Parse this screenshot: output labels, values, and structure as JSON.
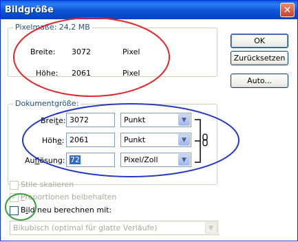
{
  "window": {
    "title": "Bildgröße",
    "close_glyph": "✕"
  },
  "pixel_dimensions": {
    "legend": "Pixelmaße: 24,2 MB",
    "width_label": "Breite:",
    "width_value": "3072",
    "width_unit": "Pixel",
    "height_label": "Höhe:",
    "height_value": "2061",
    "height_unit": "Pixel"
  },
  "buttons": {
    "ok": "OK",
    "reset": "Zurücksetzen",
    "auto": "Auto..."
  },
  "document_size": {
    "legend": "Dokumentgröße:",
    "width_label_pre": "Brei",
    "width_label_ul": "t",
    "width_label_post": "e:",
    "width_value": "3072",
    "width_unit": "Punkt",
    "height_label_pre": "Höh",
    "height_label_ul": "e",
    "height_label_post": ":",
    "height_value": "2061",
    "height_unit": "Punkt",
    "res_label_pre": "Au",
    "res_label_ul": "f",
    "res_label_post": "lösung:",
    "res_value": "72",
    "res_unit": "Pixel/Zoll",
    "link_icon": "chain-link-icon"
  },
  "options": {
    "scale_styles": "Stile skalieren",
    "constrain_pre": "",
    "constrain_ul": "P",
    "constrain_post": "roportionen beibehalten",
    "resample_pre": "B",
    "resample_ul": "i",
    "resample_post": "ld neu berechnen mit:",
    "resample_method": "Bikubisch (optimal für glatte Verläufe)"
  },
  "colors": {
    "annotation_red": "#e3262b",
    "annotation_blue": "#2436c8",
    "annotation_green": "#3aa03a",
    "legend_blue": "#1c5180"
  }
}
